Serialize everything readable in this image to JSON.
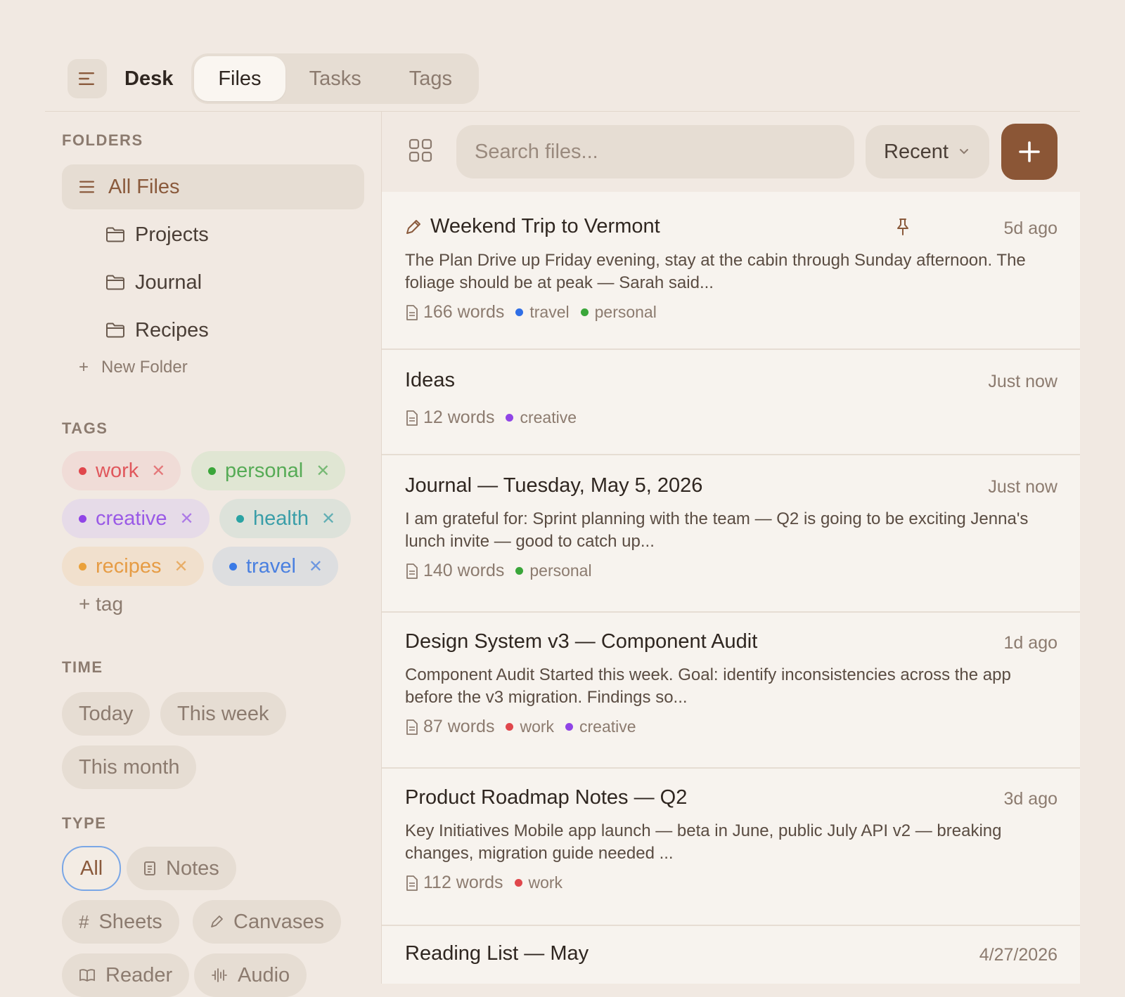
{
  "header": {
    "app_title": "Desk",
    "tabs": [
      {
        "label": "Files",
        "active": true
      },
      {
        "label": "Tasks",
        "active": false
      },
      {
        "label": "Tags",
        "active": false
      }
    ]
  },
  "sidebar": {
    "folders_label": "FOLDERS",
    "all_files": "All Files",
    "folders": [
      "Projects",
      "Journal",
      "Recipes"
    ],
    "new_folder": "New Folder",
    "tags_label": "TAGS",
    "tags": [
      {
        "name": "work",
        "color": "#e0474c",
        "text_color": "#e0575c",
        "bg": "#f0dcd7"
      },
      {
        "name": "personal",
        "color": "#3aa63a",
        "text_color": "#56ab56",
        "bg": "#e0e6d3"
      },
      {
        "name": "creative",
        "color": "#9045e6",
        "text_color": "#9a5ae6",
        "bg": "#e6dbe8"
      },
      {
        "name": "health",
        "color": "#2aa3a3",
        "text_color": "#3a9ea8",
        "bg": "#dde2da"
      },
      {
        "name": "recipes",
        "color": "#eaa13a",
        "text_color": "#e69c45",
        "bg": "#f1e0cd"
      },
      {
        "name": "travel",
        "color": "#3a7ae6",
        "text_color": "#4a80e0",
        "bg": "#dddee0"
      }
    ],
    "add_tag": "+ tag",
    "time_label": "TIME",
    "time_filters": [
      "Today",
      "This week",
      "This month"
    ],
    "type_label": "TYPE",
    "type_filters": [
      {
        "label": "All",
        "icon": "",
        "selected": true
      },
      {
        "label": "Notes",
        "icon": "document-icon",
        "selected": false
      },
      {
        "label": "Sheets",
        "icon": "grid-hash-icon",
        "selected": false
      },
      {
        "label": "Canvases",
        "icon": "pencil-icon",
        "selected": false
      },
      {
        "label": "Reader",
        "icon": "book-icon",
        "selected": false
      },
      {
        "label": "Audio",
        "icon": "waveform-icon",
        "selected": false
      }
    ]
  },
  "toolbar": {
    "search_placeholder": "Search files...",
    "sort_label": "Recent"
  },
  "files": [
    {
      "title": "Weekend Trip to Vermont",
      "time": "5d ago",
      "excerpt": "The Plan Drive up Friday evening, stay at the cabin through Sunday afternoon. The foliage should be at peak — Sarah said...",
      "words": "166 words",
      "tags": [
        {
          "name": "travel",
          "color": "#2f6ee6"
        },
        {
          "name": "personal",
          "color": "#3aa63a"
        }
      ],
      "pinned": true,
      "icon": "pencil-icon"
    },
    {
      "title": "Ideas",
      "time": "Just now",
      "excerpt": "",
      "words": "12 words",
      "tags": [
        {
          "name": "creative",
          "color": "#9045e6"
        }
      ],
      "pinned": false
    },
    {
      "title": "Journal — Tuesday, May 5, 2026",
      "time": "Just now",
      "excerpt": "I am grateful for: Sprint planning with the team — Q2 is going to be exciting Jenna's lunch invite — good to catch up...",
      "words": "140 words",
      "tags": [
        {
          "name": "personal",
          "color": "#3aa63a"
        }
      ],
      "pinned": false
    },
    {
      "title": "Design System v3 — Component Audit",
      "time": "1d ago",
      "excerpt": "Component Audit Started this week. Goal: identify inconsistencies across the app before the v3 migration. Findings so...",
      "words": "87 words",
      "tags": [
        {
          "name": "work",
          "color": "#e0474c"
        },
        {
          "name": "creative",
          "color": "#9045e6"
        }
      ],
      "pinned": false
    },
    {
      "title": "Product Roadmap Notes — Q2",
      "time": "3d ago",
      "excerpt": "Key Initiatives Mobile app launch — beta in June, public July API v2 — breaking changes, migration guide needed ...",
      "words": "112 words",
      "tags": [
        {
          "name": "work",
          "color": "#e0474c"
        }
      ],
      "pinned": false
    },
    {
      "title": "Reading List — May",
      "time": "4/27/2026",
      "excerpt": "",
      "words": "",
      "tags": [],
      "pinned": false
    }
  ]
}
